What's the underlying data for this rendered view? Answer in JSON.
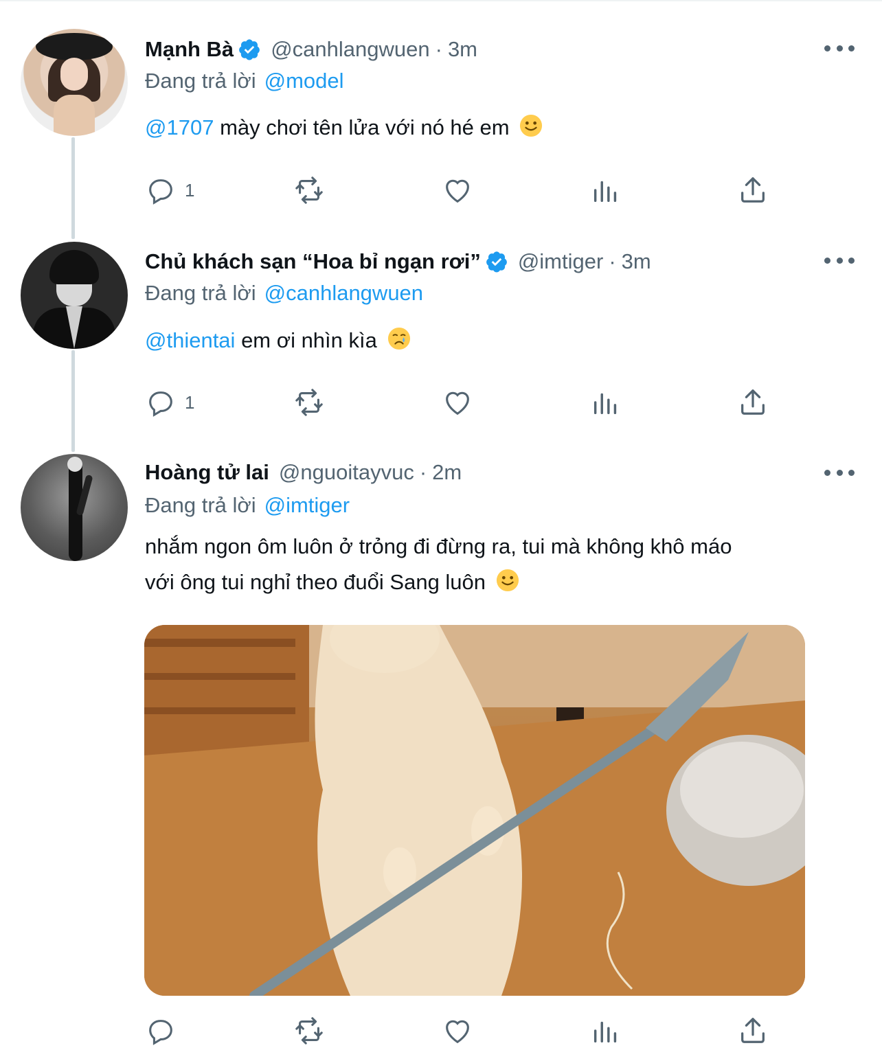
{
  "replying_prefix": "Đang trả lời",
  "tweets": [
    {
      "name": "Mạnh Bà",
      "verified": true,
      "handle": "@canhlangwuen",
      "dot": "·",
      "time": "3m",
      "reply_to": "@model",
      "text_mention": "@1707",
      "text": "mày chơi tên lửa với nó hé em",
      "emoji": "slightly-smiling-face",
      "reply_count": "1"
    },
    {
      "name": "Chủ khách sạn “Hoa bỉ ngạn rơi”",
      "verified": true,
      "handle": "@imtiger",
      "dot": "·",
      "time": "3m",
      "reply_to": "@canhlangwuen",
      "text_mention": "@thientai",
      "text": "em ơi nhìn kìa",
      "emoji": "crying-face",
      "reply_count": "1"
    },
    {
      "name": "Hoàng tử lai",
      "verified": false,
      "handle": "@nguoitayvuc",
      "dot": "·",
      "time": "2m",
      "reply_to": "@imtiger",
      "text_line1": "nhắm ngon ôm luôn ở trỏng đi đừng ra, tui mà không khô máo",
      "text_line2": "với ông tui nghỉ theo đuổi Sang luôn",
      "emoji": "slightly-smiling-face",
      "media": "photo of a cat standing upright holding a spear"
    }
  ],
  "colors": {
    "link": "#1d9bf0",
    "secondary": "#536471",
    "text": "#0f1419"
  }
}
